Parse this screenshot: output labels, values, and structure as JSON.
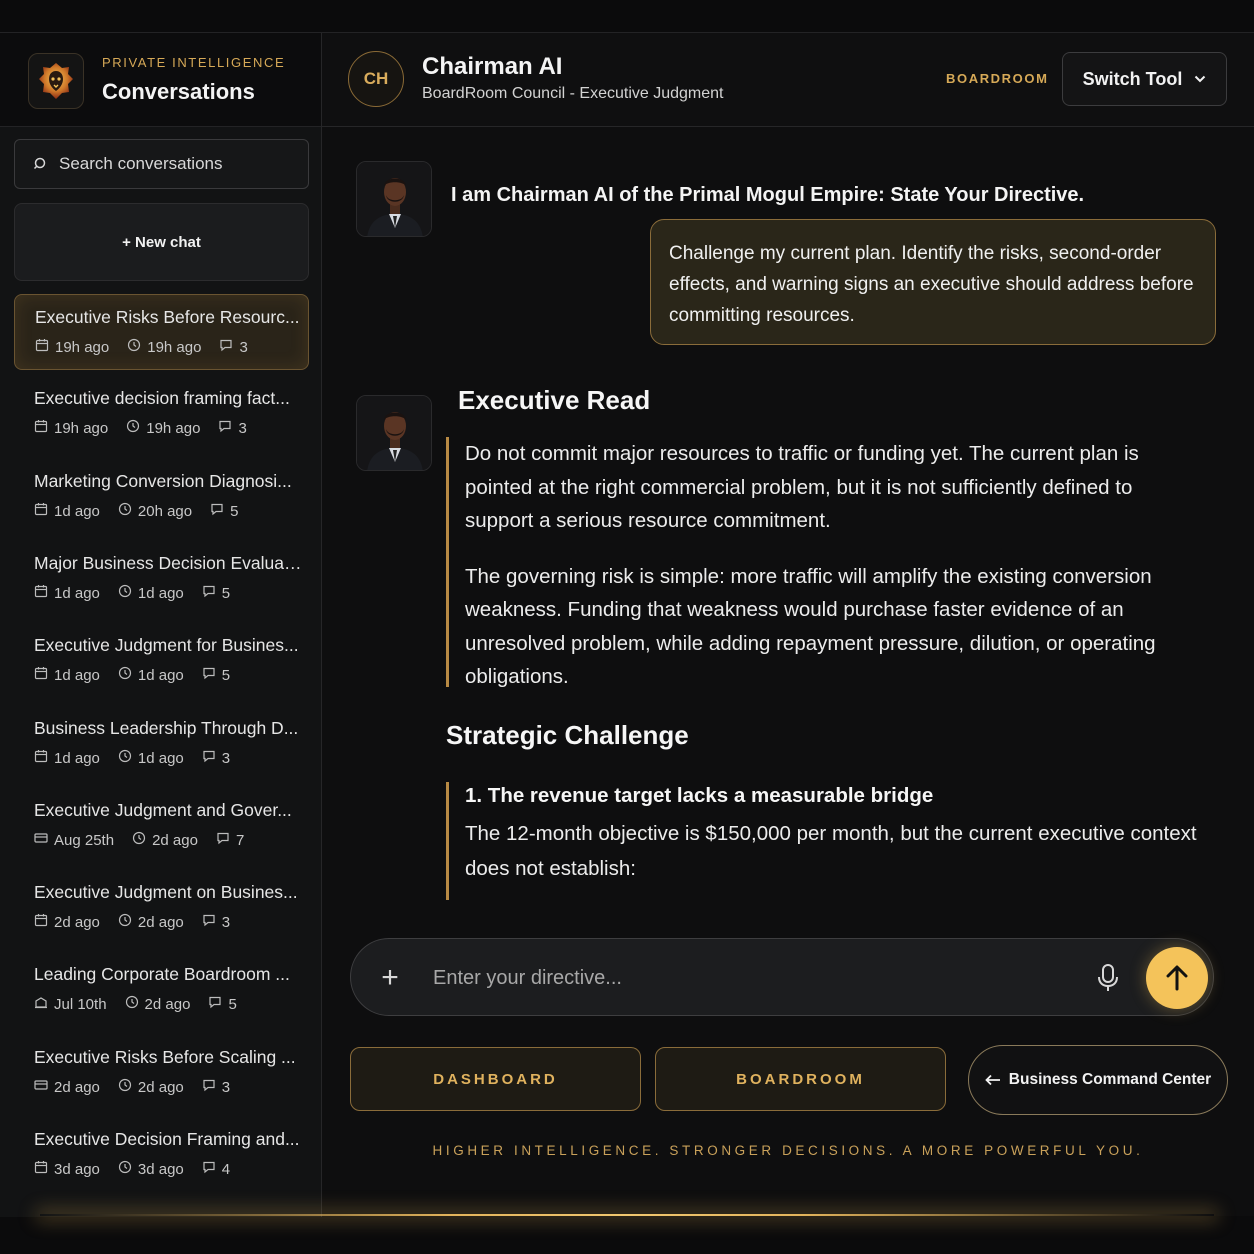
{
  "sidebar": {
    "eyebrow": "PRIVATE INTELLIGENCE",
    "title": "Conversations",
    "search_placeholder": "Search conversations",
    "new_chat_label": "+ New chat",
    "conversations": [
      {
        "title": "Executive Risks Before Resourc...",
        "created": "19h ago",
        "updated": "19h ago",
        "count": "3",
        "active": true,
        "icon": "calendar-icon"
      },
      {
        "title": "Executive decision framing fact...",
        "created": "19h ago",
        "updated": "19h ago",
        "count": "3",
        "icon": "calendar-icon"
      },
      {
        "title": "Marketing Conversion Diagnosi...",
        "created": "1d ago",
        "updated": "20h ago",
        "count": "5",
        "icon": "calendar-icon"
      },
      {
        "title": "Major Business Decision Evaluat...",
        "created": "1d ago",
        "updated": "1d ago",
        "count": "5",
        "icon": "calendar-icon"
      },
      {
        "title": "Executive Judgment for Busines...",
        "created": "1d ago",
        "updated": "1d ago",
        "count": "5",
        "icon": "calendar-icon"
      },
      {
        "title": "Business Leadership Through D...",
        "created": "1d ago",
        "updated": "1d ago",
        "count": "3",
        "icon": "calendar-icon"
      },
      {
        "title": "Executive Judgment and Gover...",
        "created": "Aug 25th",
        "updated": "2d ago",
        "count": "7",
        "icon": "card-icon"
      },
      {
        "title": "Executive Judgment on Busines...",
        "created": "2d ago",
        "updated": "2d ago",
        "count": "3",
        "icon": "calendar-icon"
      },
      {
        "title": "Leading Corporate Boardroom ...",
        "created": "Jul 10th",
        "updated": "2d ago",
        "count": "5",
        "icon": "building-icon"
      },
      {
        "title": "Executive Risks Before Scaling ...",
        "created": "2d ago",
        "updated": "2d ago",
        "count": "3",
        "icon": "card-icon"
      },
      {
        "title": "Executive Decision Framing and...",
        "created": "3d ago",
        "updated": "3d ago",
        "count": "4",
        "icon": "calendar-icon"
      }
    ]
  },
  "header": {
    "badge": "CH",
    "title": "Chairman AI",
    "subtitle": "BoardRoom Council - Executive Judgment",
    "boardroom_label": "BOARDROOM",
    "switch_label": "Switch Tool"
  },
  "chat": {
    "intro": "I am Chairman AI of the Primal Mogul Empire: State Your Directive.",
    "user_message": "Challenge my current plan. Identify the risks, second-order effects, and warning signs an executive should address before committing resources.",
    "exec_read_heading": "Executive Read",
    "exec_read_p1": "Do not commit major resources to traffic or funding yet. The current plan is pointed at the right commercial problem, but it is not sufficiently defined to support a serious resource commitment.",
    "exec_read_p2": "The governing risk is simple: more traffic will amplify the existing conversion weakness. Funding that weakness would purchase faster evidence of an unresolved problem, while adding repayment pressure, dilution, or operating obligations.",
    "strategic_heading": "Strategic Challenge",
    "point1_heading": "1. The revenue target lacks a measurable bridge",
    "point1_body": "The 12-month objective is $150,000 per month, but the current executive context does not establish:"
  },
  "composer": {
    "placeholder": "Enter your directive..."
  },
  "footer": {
    "dashboard_label": "DASHBOARD",
    "boardroom_label": "BOARDROOM",
    "bcc_label": "Business Command Center",
    "tagline": "HIGHER INTELLIGENCE. STRONGER DECISIONS. A MORE POWERFUL YOU."
  },
  "colors": {
    "accent_gold": "#d6a957",
    "send_button": "#f4c35a",
    "background": "#0e0e0f"
  }
}
